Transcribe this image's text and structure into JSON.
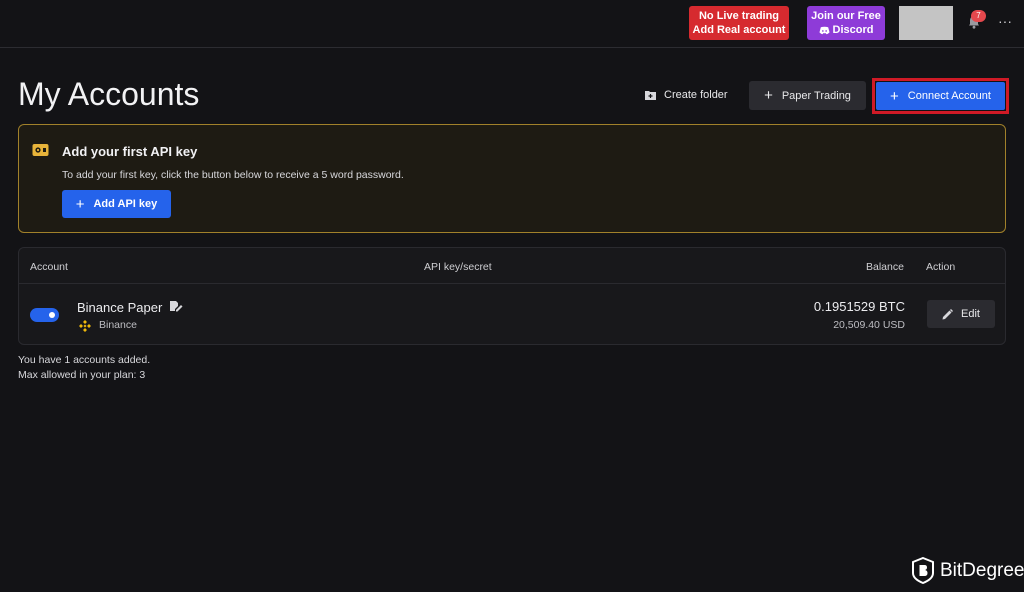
{
  "topbar": {
    "live_line1": "No Live trading",
    "live_line2": "Add Real account",
    "discord_line1": "Join our Free",
    "discord_line2": "Discord",
    "notification_count": "7",
    "more_label": "···",
    "colors": {
      "live": "#d62a2f",
      "discord": "#8e3bd8",
      "badge": "#e5484d"
    }
  },
  "header": {
    "title": "My Accounts",
    "create_folder_label": "Create folder",
    "paper_trading_label": "Paper Trading",
    "connect_account_label": "Connect Account",
    "plus": "+"
  },
  "banner": {
    "title": "Add your first API key",
    "text": "To add your first key, click the button below to receive a 5 word password.",
    "button_label": "Add API key",
    "colors": {
      "border": "#a1812a",
      "icon": "#e8b43a"
    }
  },
  "table": {
    "headers": {
      "account": "Account",
      "api": "API key/secret",
      "balance": "Balance",
      "action": "Action"
    },
    "rows": [
      {
        "enabled": true,
        "name": "Binance Paper",
        "exchange": "Binance",
        "balance_btc": "0.1951529 BTC",
        "balance_usd": "20,509.40 USD",
        "edit_label": "Edit"
      }
    ]
  },
  "footnote": {
    "line1": "You have 1 accounts added.",
    "line2": "Max allowed in your plan: 3"
  },
  "watermark": {
    "text": "BitDegree"
  },
  "colors": {
    "accent": "#2563eb",
    "background": "#131316",
    "highlight_border": "#d01a26"
  }
}
